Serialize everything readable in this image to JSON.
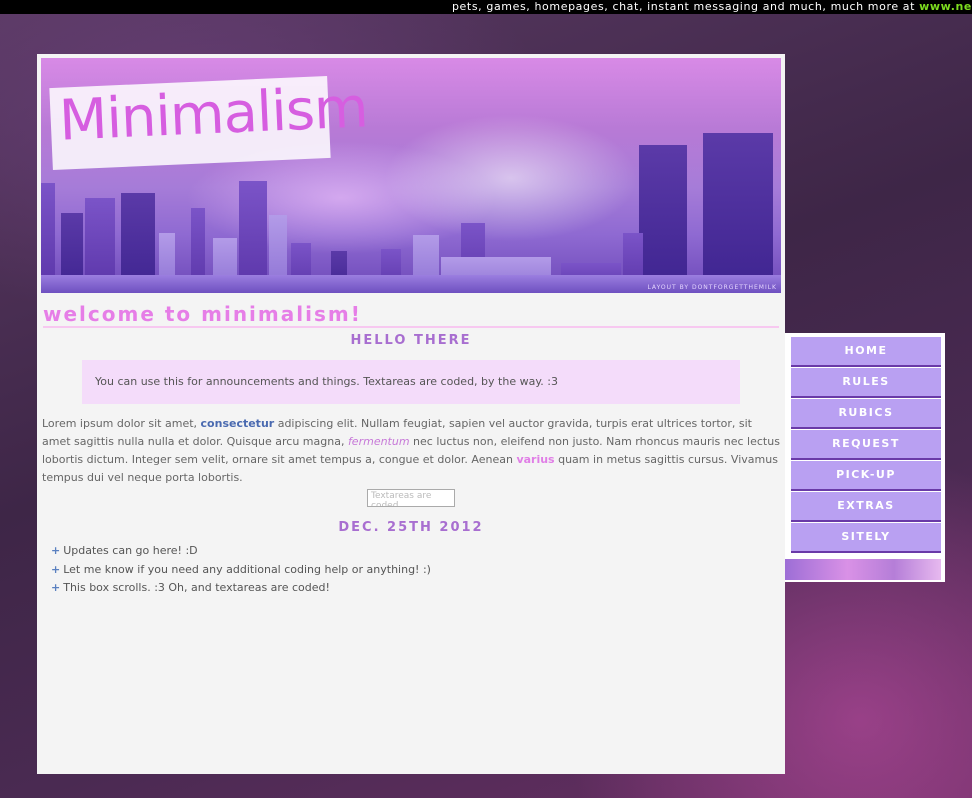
{
  "topbar": {
    "text": "pets, games, homepages, chat, instant messaging and much, much more at ",
    "site": "www.ne"
  },
  "header": {
    "logo": "Minimalism",
    "credit": "LAYOUT BY DONTFORGETTHEMILK"
  },
  "welcome": "welcome to minimalism!",
  "hello_title": "HELLO THERE",
  "announcement": "You can use this for announcements and things. Textareas are coded, by the way. :3",
  "lorem": {
    "t1": "Lorem ipsum dolor sit amet, ",
    "bold1": "consectetur",
    "t2": " adipiscing elit. Nullam feugiat, sapien vel auctor gravida, turpis erat ultrices tortor, sit amet sagittis nulla nulla et dolor. Quisque arcu magna, ",
    "italic": "fermentum",
    "t3": " nec luctus non, eleifend non justo. Nam rhoncus mauris nec lectus lobortis dictum. Integer sem velit, ornare sit amet tempus a, congue et dolor. Aenean ",
    "bold2": "varius",
    "t4": " quam in metus sagittis cursus. Vivamus tempus dui vel neque porta lobortis."
  },
  "textarea": {
    "value": "Textareas are coded"
  },
  "date_title": "DEC. 25TH 2012",
  "updates": [
    "Updates can go here! :D",
    "Let me know if you need any additional coding help or anything! :)",
    "This box scrolls. :3 Oh, and textareas are coded!"
  ],
  "update_marker": "+",
  "nav": [
    "HOME",
    "RULES",
    "RUBICS",
    "REQUEST",
    "PICK-UP",
    "EXTRAS",
    "SITELY"
  ],
  "colors": {
    "accent_pink": "#e67ee7",
    "accent_purple": "#a86ed0",
    "nav_button": "#b9a0f2"
  }
}
